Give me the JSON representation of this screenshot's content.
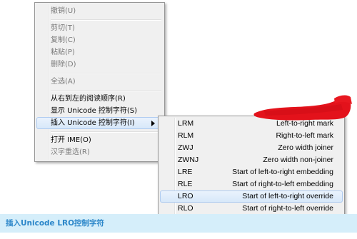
{
  "context_menu": {
    "highlighted_index": 11,
    "items": [
      {
        "type": "item",
        "label": "撤销(U)",
        "enabled": false
      },
      {
        "type": "separator"
      },
      {
        "type": "item",
        "label": "剪切(T)",
        "enabled": false
      },
      {
        "type": "item",
        "label": "复制(C)",
        "enabled": false
      },
      {
        "type": "item",
        "label": "粘贴(P)",
        "enabled": false
      },
      {
        "type": "item",
        "label": "删除(D)",
        "enabled": false
      },
      {
        "type": "separator"
      },
      {
        "type": "item",
        "label": "全选(A)",
        "enabled": false
      },
      {
        "type": "separator"
      },
      {
        "type": "item",
        "label": "从右到左的阅读顺序(R)",
        "enabled": true
      },
      {
        "type": "item",
        "label": "显示 Unicode 控制字符(S)",
        "enabled": true
      },
      {
        "type": "item",
        "label": "插入 Unicode 控制字符(I)",
        "enabled": true,
        "has_submenu": true,
        "submenu_icon": "submenu-arrow-icon"
      },
      {
        "type": "separator"
      },
      {
        "type": "item",
        "label": "打开 IME(O)",
        "enabled": true
      },
      {
        "type": "item",
        "label": "汉字重选(R)",
        "enabled": false
      }
    ]
  },
  "submenu": {
    "highlighted_index": 6,
    "items": [
      {
        "code": "LRM",
        "description": "Left-to-right mark"
      },
      {
        "code": "RLM",
        "description": "Right-to-left mark"
      },
      {
        "code": "ZWJ",
        "description": "Zero width joiner"
      },
      {
        "code": "ZWNJ",
        "description": "Zero width non-joiner"
      },
      {
        "code": "LRE",
        "description": "Start of left-to-right embedding"
      },
      {
        "code": "RLE",
        "description": "Start of right-to-left embedding"
      },
      {
        "code": "LRO",
        "description": "Start of left-to-right override"
      },
      {
        "code": "RLO",
        "description": "Start of right-to-left override"
      }
    ]
  },
  "caption_bar": {
    "text": "插入Unicode LRO控制字符"
  },
  "colors": {
    "menu_background": "#f0f0f0",
    "menu_border": "#979797",
    "highlight_background": "#d6e7f9",
    "highlight_border": "#aecbf0",
    "disabled_text": "#7a7a7a",
    "caption_bar_background": "#d5eefa",
    "caption_text": "#2b86c9",
    "redaction_mark": "#e3121b"
  }
}
